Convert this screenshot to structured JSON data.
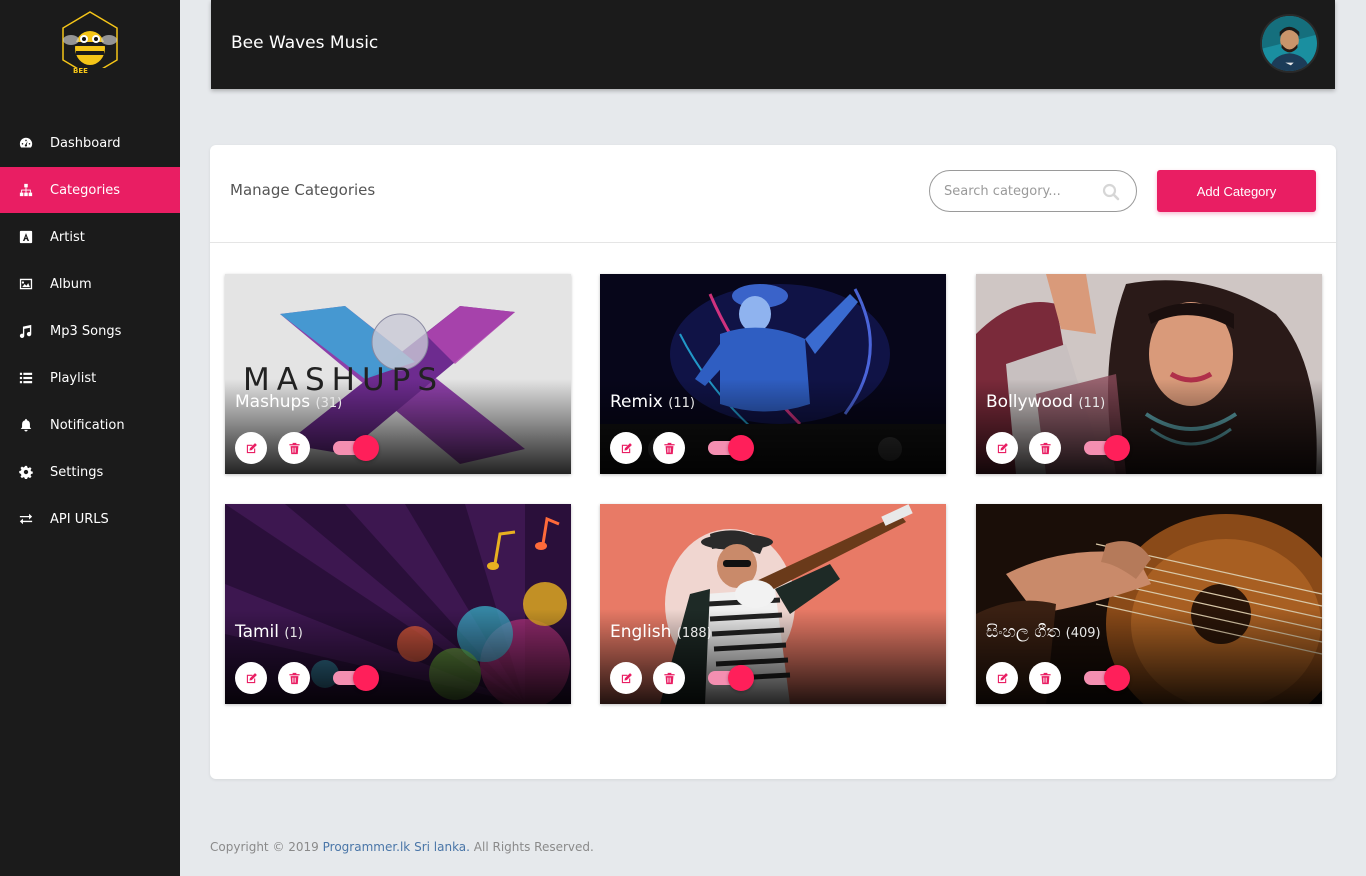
{
  "app": {
    "logo_text": "BEE",
    "title": "Bee Waves Music"
  },
  "sidebar": {
    "items": [
      {
        "label": "Dashboard",
        "icon": "dashboard-icon",
        "active": false
      },
      {
        "label": "Categories",
        "icon": "sitemap-icon",
        "active": true
      },
      {
        "label": "Artist",
        "icon": "artist-icon",
        "active": false
      },
      {
        "label": "Album",
        "icon": "image-icon",
        "active": false
      },
      {
        "label": "Mp3 Songs",
        "icon": "music-note-icon",
        "active": false
      },
      {
        "label": "Playlist",
        "icon": "list-icon",
        "active": false
      },
      {
        "label": "Notification",
        "icon": "bell-icon",
        "active": false
      },
      {
        "label": "Settings",
        "icon": "gear-icon",
        "active": false
      },
      {
        "label": "API URLS",
        "icon": "exchange-icon",
        "active": false
      }
    ]
  },
  "main": {
    "title": "Manage Categories",
    "search_placeholder": "Search category...",
    "add_button": "Add Category"
  },
  "categories": [
    {
      "name": "Mashups",
      "count": "(31)",
      "art_text": "MASHUPS",
      "enabled": true
    },
    {
      "name": "Remix",
      "count": "(11)",
      "enabled": true
    },
    {
      "name": "Bollywood",
      "count": "(11)",
      "enabled": true
    },
    {
      "name": "Tamil",
      "count": "(1)",
      "enabled": true
    },
    {
      "name": "English",
      "count": "(188)",
      "enabled": true
    },
    {
      "name": "සිංහල ගීත",
      "count": "(409)",
      "enabled": true
    }
  ],
  "footer": {
    "prefix": "Copyright © 2019 ",
    "link": "Programmer.lk Sri lanka.",
    "suffix": " All Rights Reserved."
  },
  "colors": {
    "accent": "#e91e63",
    "sidebar_bg": "#1b1b1b",
    "page_bg": "#e6e9ec",
    "toggle_knob": "#ff1f5a"
  }
}
